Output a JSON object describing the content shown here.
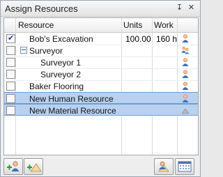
{
  "window": {
    "title": "Assign Resources"
  },
  "titlebar_buttons": {
    "pin": "↧",
    "close": "✕"
  },
  "columns": {
    "resource": "Resource",
    "units": "Units",
    "work": "Work"
  },
  "rows": [
    {
      "name": "Bob's Excavation",
      "units": "100.00",
      "work": "160 h",
      "checked": true,
      "indent": 1,
      "icon": "human-resource-icon"
    },
    {
      "name": "Surveyor",
      "units": "",
      "work": "",
      "checked": false,
      "indent": 1,
      "expander": true,
      "icon": "group-resource-icon"
    },
    {
      "name": "Surveyor 1",
      "units": "",
      "work": "",
      "checked": false,
      "indent": 2,
      "icon": "human-resource-icon"
    },
    {
      "name": "Surveyor 2",
      "units": "",
      "work": "",
      "checked": false,
      "indent": 2,
      "icon": "human-resource-icon"
    },
    {
      "name": "Baker Flooring",
      "units": "",
      "work": "",
      "checked": false,
      "indent": 1,
      "icon": "human-resource-icon"
    },
    {
      "name": "New Human Resource",
      "units": "",
      "work": "",
      "checked": false,
      "indent": 1,
      "selected": true,
      "icon": "human-resource-icon"
    },
    {
      "name": "New Material Resource",
      "units": "",
      "work": "",
      "checked": false,
      "indent": 1,
      "selected": true,
      "icon": "material-resource-icon"
    }
  ],
  "toolbar": [
    {
      "icon": "add-human-resource-icon"
    },
    {
      "icon": "add-material-resource-icon"
    },
    {
      "icon": "resource-sheet-icon"
    },
    {
      "icon": "calendar-icon"
    }
  ],
  "colors": {
    "selection": "#b9d1ee",
    "selection_border": "#6a9fd6",
    "person": "#e07a3a",
    "person_head": "#f2c39b",
    "person_body": "#3a6fbf"
  }
}
